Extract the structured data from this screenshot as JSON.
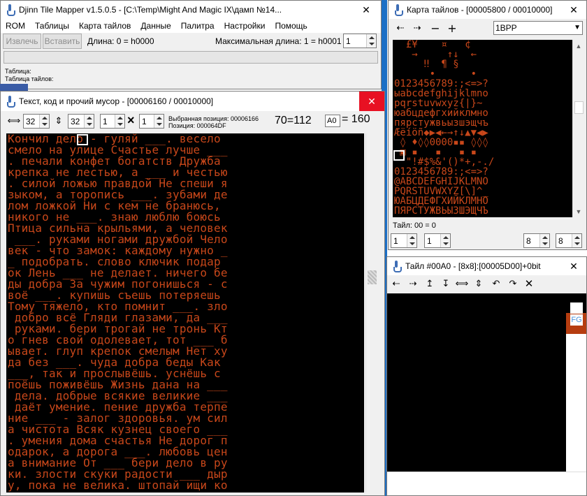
{
  "main_window": {
    "title": "Djinn Tile Mapper v1.5.0.5 - [C:\\Temp\\Might And Magic IX\\дамп №14...",
    "menu": [
      "ROM",
      "Таблицы",
      "Карта тайлов",
      "Данные",
      "Палитра",
      "Настройки",
      "Помощь"
    ],
    "extract_label": "Извлечь",
    "insert_label": "Вставить",
    "length_text": "Длина: 0 = h0000",
    "max_length_text": "Максимальная длина: 1 = h0001",
    "spin_value": "1",
    "table_label": "Таблица:",
    "tile_table_label": "Таблица тайлов:"
  },
  "text_window": {
    "title": "Текст, код и прочий мусор - [00006160 / 00010000]",
    "spin_values": [
      "32",
      "32",
      "1",
      "1"
    ],
    "multiply_symbol": "×",
    "selected_position": "Выбранная позиция: 00006166",
    "position": "Позиция: 000064DF",
    "char_code": "70=112",
    "hex_input": "A0",
    "hex_result": "= 160",
    "lines": [
      "Кончил дело - гуляй ___. весело",
      "смело на улице Счастье лучше ___",
      ". печали конфет богатств Дружба",
      "крепка не лестью, а ___ и честью",
      ". силой ложью правдой Не спеши я",
      "зыком, а торопись ___. зубами де",
      "лом ложкой Ни с кем не бранюсь,",
      "никого не ___. знаю люблю боюсь",
      "Птица сильна крыльями, а человек",
      " ___. руками ногами дружбой Чело",
      "век - что замок: каждому нужно _",
      "_ подобрать. слово ключик подар",
      "ок Лень ___ не делает. ничего бе",
      "ды добра За чужим погонишься - с",
      "воё ___. купишь съешь потеряешь",
      "Тому тяжело, кто помнит ___. зло",
      " добро всё Гляди глазами, да ___",
      " руками. бери трогай не тронь Кт",
      "о гнев свой одолевает, тот ___ б",
      "ывает. глуп крепок смелым Нет ху",
      "да без ___. чуда добра беды Как",
      "___, так и прослывёшь. уснёшь с",
      "поёшь поживёшь Жизнь дана на ___",
      " дела. добрые всякие великие ___",
      " даёт умение. пение дружба терпе",
      "ние ___ - залог здоровья. ум сил",
      "а чистота Всяк кузнец своего ___",
      ". умения дома счастья Не дорог п",
      "одарок, а дорога ___. любовь цен",
      "а внимание От ___ бери дело в ру",
      "ки. злости скуки радости ___ дыр",
      "у, пока не велика. штопай ищи ко"
    ]
  },
  "tilemap_window": {
    "title": "Карта тайлов - [00005800 / 00010000]",
    "mode": "1BPP",
    "rows": [
      "  £¥    ¤   ¢  ",
      "   →     ↑↓  ← ",
      "     ‼  ¶ §    ",
      "      •      • ",
      "0123456789:;<=>?",
      "ыabcdefghijklmno",
      "pqrstuvwxyz{|}~ ",
      "юабцдефгхийклмно",
      "пярстужвьызшэщчъ",
      "Æëíöñ◆▶◀←→↑↓▲▼◀▶",
      " ◊ ♦◊◊0000▪▪ ◊◊◊",
      " ▣ ▪   ▪   ▪ ▪  ",
      "  \"!#$%&'()*+,-./",
      "0123456789:;<=>?",
      "@ABCDEFGHIJKLMNO",
      "PQRSTUVWXYZ[\\]^_",
      "ЮАБЦДЕФГХИЙКЛМНО",
      "ПЯРСТУЖВЬЫЗШЭЩЧЪ"
    ],
    "tile_info": "Тайл: 00 = 0",
    "spin_values": [
      "1",
      "1",
      "8",
      "8"
    ]
  },
  "tile_window": {
    "title": "Тайл #00A0 - [8x8]:[00005D00]+0bit",
    "fg_label": "FG"
  }
}
